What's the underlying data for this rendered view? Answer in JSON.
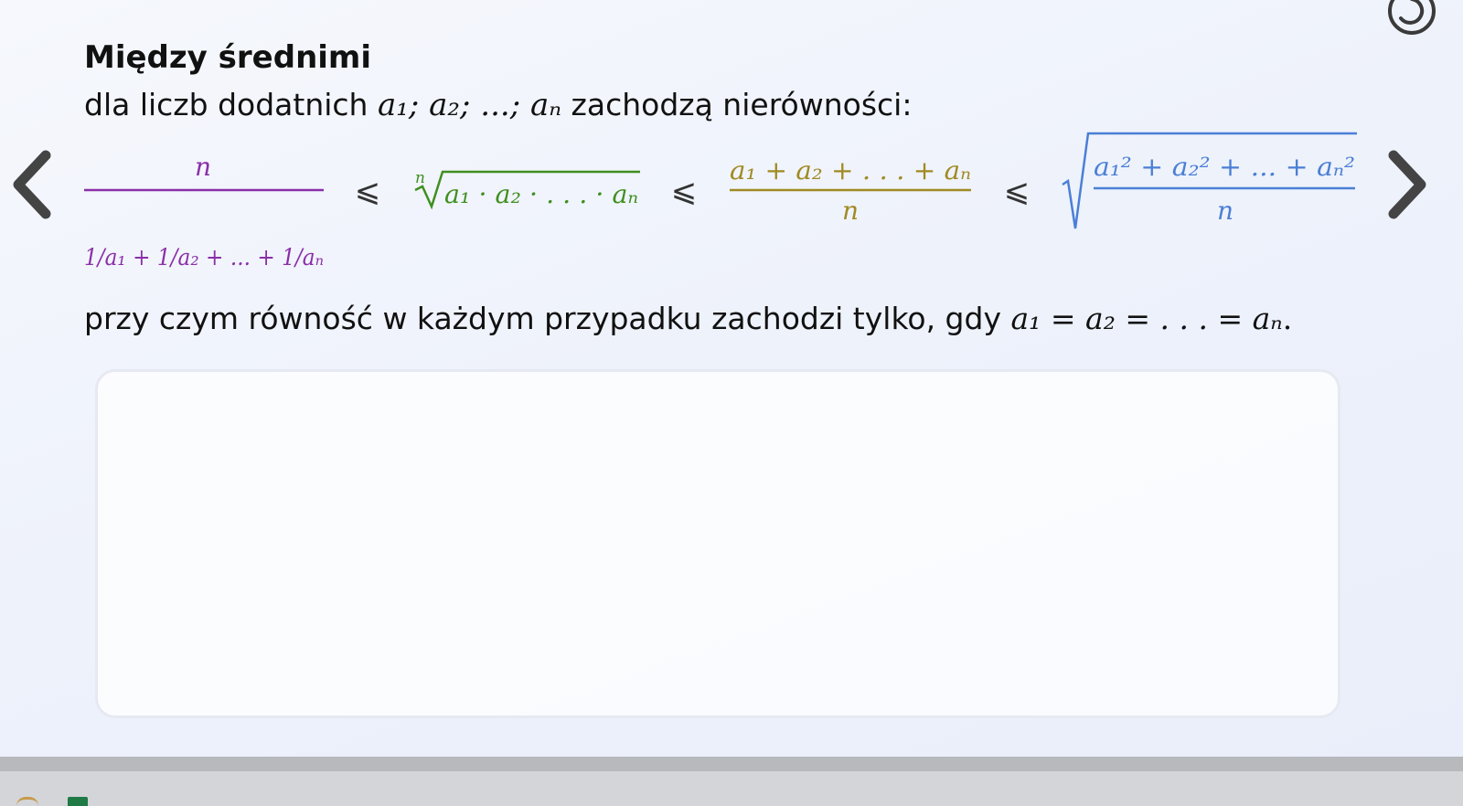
{
  "title": "Między średnimi",
  "intro": {
    "text": "dla liczb dodatnich",
    "variables": "a₁;  a₂;  ...;  aₙ",
    "suffix": "zachodzą nierówności:"
  },
  "formula": {
    "relation": "⩽",
    "harmonic": {
      "color": "#8a2fa8",
      "numerator": "n",
      "denominator": "1/a₁ + 1/a₂ + ... + 1/aₙ"
    },
    "geometric": {
      "color": "#3f8f1f",
      "root_index": "n",
      "radicand": "a₁ · a₂ · . . . · aₙ"
    },
    "arithmetic": {
      "color": "#a08a22",
      "numerator": "a₁ + a₂ + . . . + aₙ",
      "denominator": "n"
    },
    "quadratic": {
      "color": "#4a7fd6",
      "numerator": "a₁² + a₂² + ... + aₙ²",
      "denominator": "n"
    }
  },
  "equality": {
    "text": "przy czym równość w każdym przypadku zachodzi tylko, gdy",
    "condition": "a₁ = a₂ = . . . = aₙ",
    "end": "."
  },
  "icons": {
    "previous": "chevron-left-icon",
    "next": "chevron-right-icon",
    "loading": "spinner-icon"
  },
  "colors": {
    "background": "#eef2fb",
    "text": "#111111",
    "arrow": "#444444"
  }
}
